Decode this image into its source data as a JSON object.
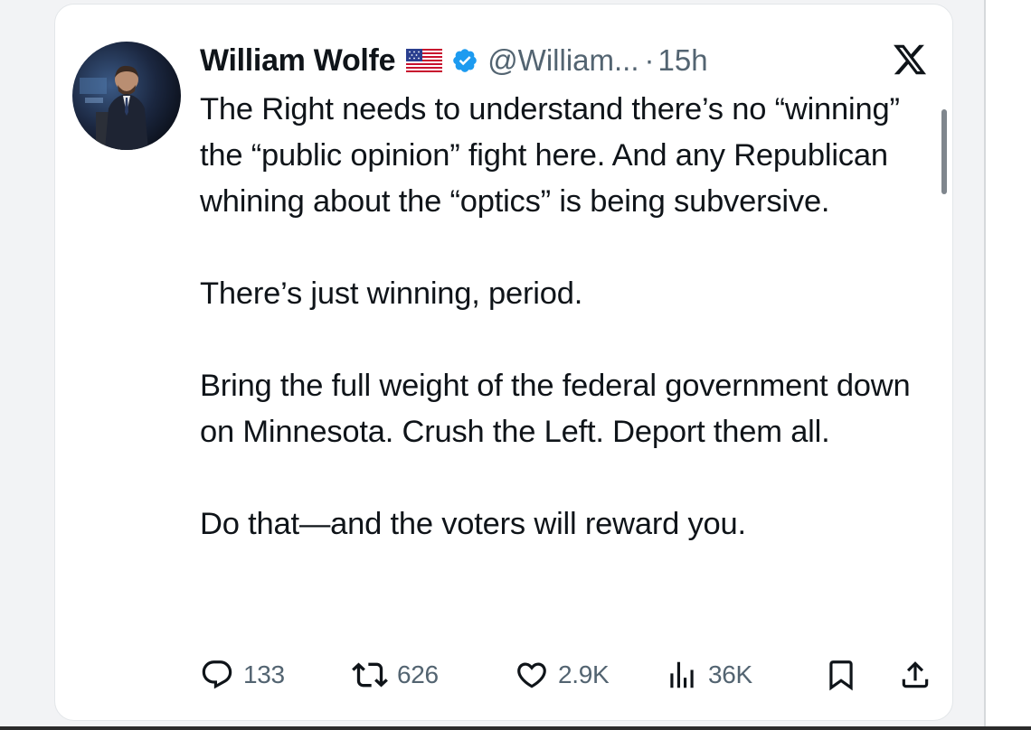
{
  "tweet": {
    "author_name": "William Wolfe",
    "handle": "@William...",
    "separator": "·",
    "time": "15h",
    "flag_icon": "us-flag-icon",
    "verified_icon": "verified-badge-icon",
    "platform_icon": "x-logo-icon",
    "paragraphs": [
      "The Right needs to understand there’s no “winning” the “public opinion” fight here. And any Republican whining about the “optics” is being subversive.",
      "There’s just winning, period.",
      "Bring the full weight of the federal government down on Minnesota. Crush the Left. Deport them all.",
      "Do that—and the voters will reward you."
    ]
  },
  "actions": {
    "replies": "133",
    "reposts": "626",
    "likes": "2.9K",
    "views": "36K",
    "icons": [
      "reply-icon",
      "repost-icon",
      "like-icon",
      "views-icon",
      "bookmark-icon",
      "share-icon"
    ]
  },
  "colors": {
    "text": "#0f1419",
    "secondary": "#536471",
    "verified": "#1d9bf0",
    "background": "#f2f3f5"
  }
}
